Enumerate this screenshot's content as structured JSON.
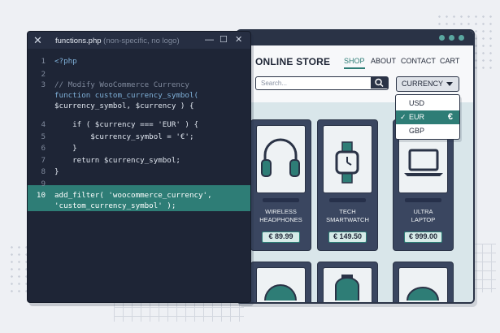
{
  "editor": {
    "tab_title": "functions.php",
    "tab_subtitle": "(non-specific, no logo)",
    "lines": [
      {
        "num": "1",
        "text": "<?php"
      },
      {
        "num": "2",
        "text": ""
      },
      {
        "num": "3",
        "text": "// Modify WooCommerce Currency"
      },
      {
        "num": "",
        "text": "function custom_currency_symbol("
      },
      {
        "num": "",
        "text": "$currency_symbol, $currency ) {"
      },
      {
        "num": "4",
        "text": "    if ( $currency === 'EUR' ) {"
      },
      {
        "num": "5",
        "text": "        $currency_symbol = '€';"
      },
      {
        "num": "6",
        "text": "    }"
      },
      {
        "num": "7",
        "text": "    return $currency_symbol;"
      },
      {
        "num": "8",
        "text": "}"
      },
      {
        "num": "9",
        "text": ""
      },
      {
        "num": "10",
        "text": "add_filter( 'woocommerce_currency',"
      },
      {
        "num": "",
        "text": "'custom_currency_symbol' );"
      }
    ]
  },
  "store": {
    "logo": "ONLINE STORE",
    "nav": [
      "SHOP",
      "ABOUT",
      "CONTACT",
      "CART"
    ],
    "search_placeholder": "Search...",
    "currency_label": "CURRENCY",
    "currency_options": [
      {
        "code": "USD",
        "symbol": ""
      },
      {
        "code": "EUR",
        "symbol": "€",
        "selected": true
      },
      {
        "code": "GBP",
        "symbol": ""
      }
    ],
    "products": [
      {
        "name_line1": "WIRELESS",
        "name_line2": "HEADPHONES",
        "price": "€ 89.99",
        "icon": "headphones-icon"
      },
      {
        "name_line1": "TECH",
        "name_line2": "SMARTWATCH",
        "price": "€ 149.50",
        "icon": "smartwatch-icon"
      },
      {
        "name_line1": "ULTRA",
        "name_line2": "LAPTOP",
        "price": "€ 999.00",
        "icon": "laptop-icon"
      }
    ]
  },
  "colors": {
    "accent": "#2e7d76",
    "dark": "#2a3346",
    "editor_bg": "#1e2536"
  }
}
